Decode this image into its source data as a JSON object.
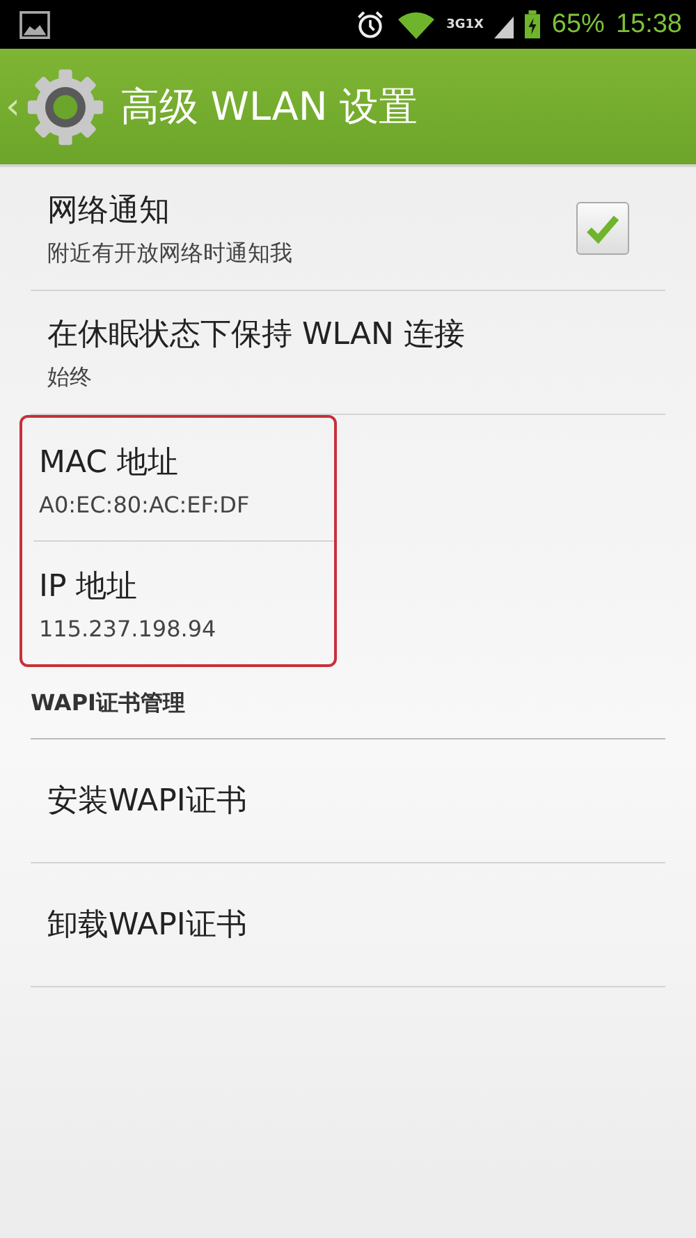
{
  "status_bar": {
    "network": "3G1X",
    "battery": "65%",
    "time": "15:38"
  },
  "action_bar": {
    "back": "‹",
    "title": "高级 WLAN 设置"
  },
  "items": [
    {
      "kind": "checkbox",
      "title": "网络通知",
      "summary": "附近有开放网络时通知我",
      "checked": true
    },
    {
      "kind": "text",
      "title": "在休眠状态下保持 WLAN 连接",
      "summary": "始终"
    },
    {
      "kind": "highlighted",
      "title": "MAC 地址",
      "summary": "A0:EC:80:AC:EF:DF"
    },
    {
      "kind": "highlighted",
      "title": "IP 地址",
      "summary": "115.237.198.94"
    },
    {
      "kind": "category",
      "title": "WAPI证书管理"
    },
    {
      "kind": "text",
      "title": "安装WAPI证书"
    },
    {
      "kind": "text",
      "title": "卸载WAPI证书"
    }
  ]
}
